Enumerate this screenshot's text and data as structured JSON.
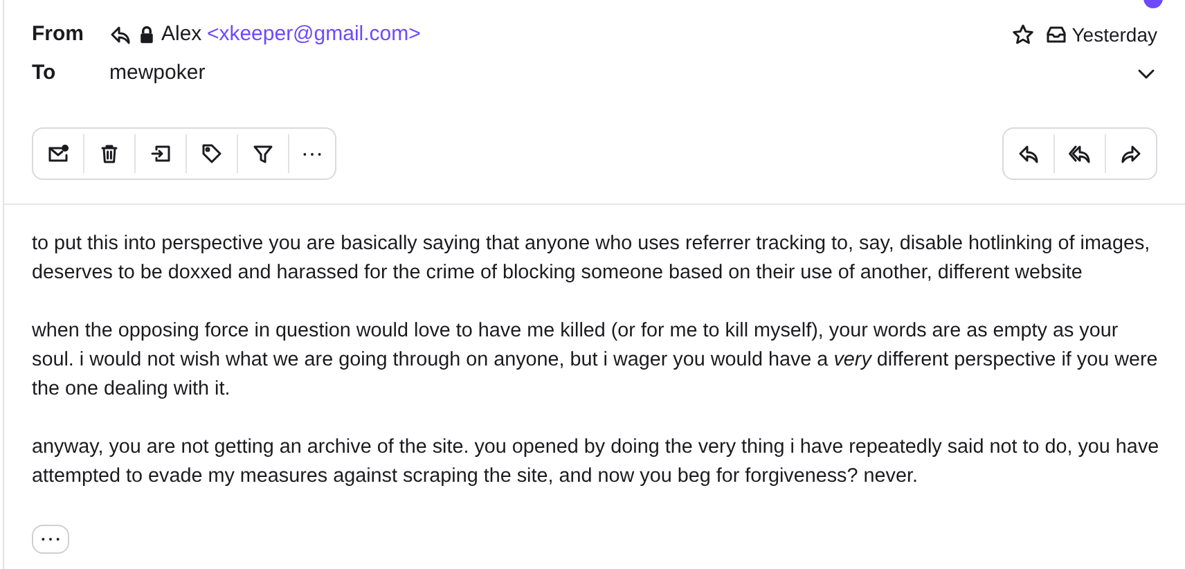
{
  "header": {
    "from_label": "From",
    "to_label": "To",
    "sender_name": "Alex",
    "sender_email": "<xkeeper@gmail.com>",
    "recipient": "mewpoker",
    "date": "Yesterday",
    "starred": false,
    "replied": true,
    "locked": true
  },
  "toolbar": [
    {
      "kind": "mark-unread"
    },
    {
      "kind": "trash"
    },
    {
      "kind": "move"
    },
    {
      "kind": "label"
    },
    {
      "kind": "filter"
    },
    {
      "kind": "more"
    }
  ],
  "reply_actions": [
    {
      "kind": "reply"
    },
    {
      "kind": "reply-all"
    },
    {
      "kind": "forward"
    }
  ],
  "body": [
    "to put this into perspective you are basically saying that anyone who uses referrer tracking to, say, disable hotlinking of images, deserves to be doxxed and harassed for the crime of blocking someone based on their use of another, different website",
    "when the opposing force in question would love to have me killed (or for me to kill myself), your words are as empty as your soul. i would not wish what we are going through on anyone, but i wager you would have a *very* different perspective if you were the one dealing with it.",
    "anyway, you are not getting an archive of the site. you opened by doing the very thing i have repeatedly said not to do, you have attempted to evade my measures against scraping the site, and now you beg for forgiveness? never."
  ]
}
